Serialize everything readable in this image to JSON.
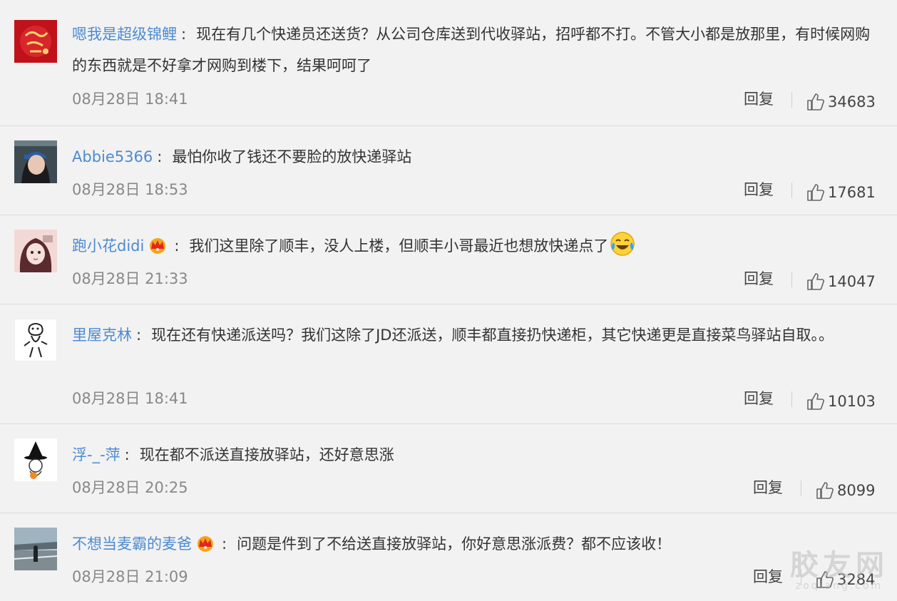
{
  "reply_label": "回复",
  "watermark": {
    "main": "胶友网",
    "sub": "zoqiang.com"
  },
  "colors": {
    "username": "#4c8bd1",
    "text": "#333333",
    "time": "#888888",
    "background": "#f2f2f2"
  },
  "comments": [
    {
      "avatar": "avatar-red-lucky-image",
      "username": "嗯我是超级锦鲤",
      "vip": false,
      "text": "现在有几个快递员还送货？从公司仓库送到代收驿站，招呼都不打。不管大小都是放那里，有时候网购的东西就是不好拿才网购到楼下，结果呵呵了",
      "time": "08月28日 18:41",
      "likes": "34683"
    },
    {
      "avatar": "avatar-girl-headband-image",
      "username": "Abbie5366",
      "vip": false,
      "text": "最怕你收了钱还不要脸的放快递驿站",
      "time": "08月28日 18:53",
      "likes": "17681"
    },
    {
      "avatar": "avatar-girl-illustration-image",
      "username": "跑小花didi",
      "vip": true,
      "text": "我们这里除了顺丰，没人上楼，但顺丰小哥最近也想放快递点了",
      "emoji": "laugh-cry-emoji",
      "time": "08月28日 21:33",
      "likes": "14047"
    },
    {
      "avatar": "avatar-sketch-figure-image",
      "username": "里屋克林",
      "vip": false,
      "text": "现在还有快递派送吗？我们这除了JD还派送，顺丰都直接扔快递柜，其它快递更是直接菜鸟驿站自取。。",
      "time": "08月28日 18:41",
      "likes": "10103"
    },
    {
      "avatar": "avatar-witch-sketch-image",
      "username": "浮-_-萍",
      "vip": false,
      "text": "现在都不派送直接放驿站，还好意思涨",
      "time": "08月28日 20:25",
      "likes": "8099"
    },
    {
      "avatar": "avatar-street-photo-image",
      "username": "不想当麦霸的麦爸",
      "vip": true,
      "text": "问题是件到了不给送直接放驿站，你好意思涨派费？都不应该收！",
      "time": "08月28日 21:09",
      "likes": "3284"
    }
  ]
}
